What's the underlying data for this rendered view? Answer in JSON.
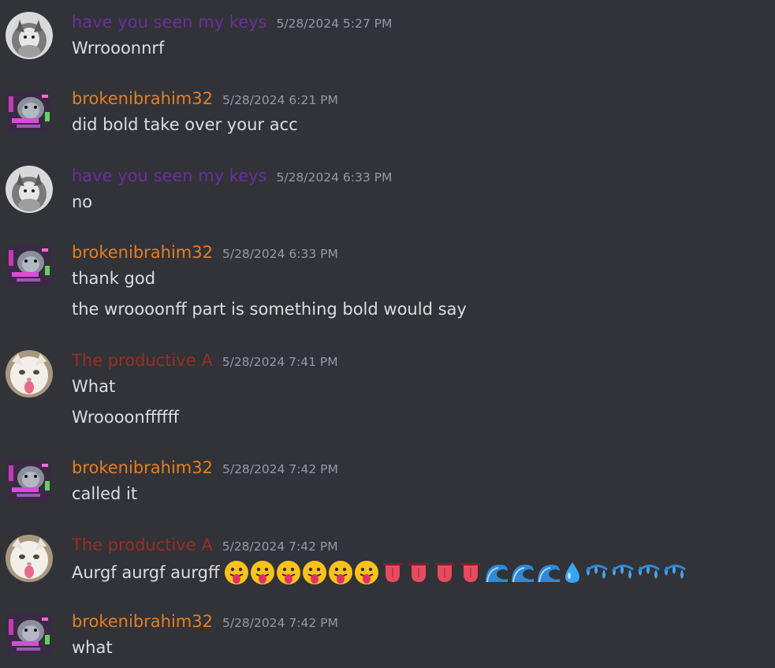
{
  "users": {
    "keys": {
      "name": "have you seen my keys",
      "color": "#6a2f9c",
      "avatar": "cat-in-hood-avatar"
    },
    "ibrahim": {
      "name": "brokenibrahim32",
      "color": "#e67e22",
      "avatar": "glitch-chinchilla-avatar"
    },
    "productive": {
      "name": "The productive A",
      "color": "#992d22",
      "avatar": "cat-tongue-avatar"
    }
  },
  "messages": [
    {
      "author": "have you seen my keys",
      "time": "5/28/2024 5:27 PM",
      "lines": [
        "Wrrooonnrf"
      ]
    },
    {
      "author": "brokenibrahim32",
      "time": "5/28/2024 6:21 PM",
      "lines": [
        "did bold take over your acc"
      ]
    },
    {
      "author": "have you seen my keys",
      "time": "5/28/2024 6:33 PM",
      "lines": [
        "no"
      ]
    },
    {
      "author": "brokenibrahim32",
      "time": "5/28/2024 6:33 PM",
      "lines": [
        "thank god",
        "the wroooonff part is something bold would say"
      ]
    },
    {
      "author": "The productive A",
      "time": "5/28/2024 7:41 PM",
      "lines": [
        "What",
        "Wroooonffffff"
      ]
    },
    {
      "author": "brokenibrahim32",
      "time": "5/28/2024 7:42 PM",
      "lines": [
        "called it"
      ]
    },
    {
      "author": "The productive A",
      "time": "5/28/2024 7:42 PM",
      "lines": [
        "Aurgf aurgf aurgff"
      ],
      "emojis": [
        "face-with-tongue-emoji",
        "face-with-tongue-emoji",
        "face-with-tongue-emoji",
        "face-with-tongue-emoji",
        "face-with-tongue-emoji",
        "face-with-tongue-emoji",
        "tongue-emoji",
        "tongue-emoji",
        "tongue-emoji",
        "tongue-emoji",
        "water-wave-emoji",
        "water-wave-emoji",
        "water-wave-emoji",
        "droplet-emoji",
        "sweat-droplets-emoji",
        "sweat-droplets-emoji",
        "sweat-droplets-emoji",
        "sweat-droplets-emoji"
      ]
    },
    {
      "author": "brokenibrahim32",
      "time": "5/28/2024 7:42 PM",
      "lines": [
        "what"
      ]
    }
  ]
}
